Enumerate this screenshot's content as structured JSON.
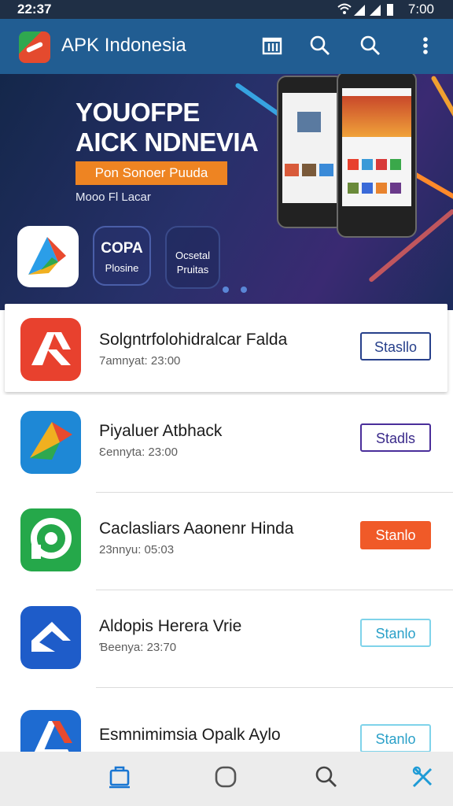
{
  "status": {
    "time_left": "22:37",
    "time_right": "7:00"
  },
  "appbar": {
    "title": "APK Indonesia",
    "icons": [
      "download-icon",
      "search-icon",
      "search-icon",
      "more-vert-icon"
    ]
  },
  "banner": {
    "headline1": "YOUOFPE",
    "headline2": "AICK NDNEVIA",
    "button_label": "Pon Sonoer Puuda",
    "subtext": "Mooo Fl Lacar",
    "chips": [
      {
        "label_top": "",
        "label_bottom": ""
      },
      {
        "label_top": "COPA",
        "label_bottom": "Plosine"
      },
      {
        "label_top": "Ocsetal",
        "label_bottom": "Pruitas"
      }
    ],
    "carousel_dots": 2
  },
  "apps": [
    {
      "name": "Solgntrfolohidralcar Falda",
      "meta": "7amnyat: 23:00",
      "button": "Stasllo",
      "button_style": "outline-navy",
      "icon_color": "#e8412e"
    },
    {
      "name": "Piyaluer Atbhack",
      "meta": "Ɛennyta: 23:00",
      "button": "Stadls",
      "button_style": "outline-purple",
      "icon_color": "#1e88d6"
    },
    {
      "name": "Caclasliars Aaonenr Hinda",
      "meta": "23nnyu: 05:03",
      "button": "Stanlo",
      "button_style": "filled-orange",
      "icon_color": "#25a84a"
    },
    {
      "name": "Aldopis Herera Vrie",
      "meta": "Ɓeenya: 23:70",
      "button": "Stanlo",
      "button_style": "outline-cyan",
      "icon_color": "#1e5cc9"
    },
    {
      "name": "Esmnimimsia Opalk Aylo",
      "meta": "",
      "button": "Stanlo",
      "button_style": "outline-cyan",
      "icon_color": "#1e6bd1"
    }
  ],
  "bottom_nav": [
    {
      "icon": "bag-icon",
      "color": "#1976d2"
    },
    {
      "icon": "home-circle-icon",
      "color": "#555555"
    },
    {
      "icon": "search-icon",
      "color": "#444444"
    },
    {
      "icon": "tools-icon",
      "color": "#1e9bd6"
    }
  ],
  "colors": {
    "appbar": "#215d92",
    "statusbar": "#1f2f45",
    "orange": "#f05a28",
    "navy": "#27408b"
  }
}
